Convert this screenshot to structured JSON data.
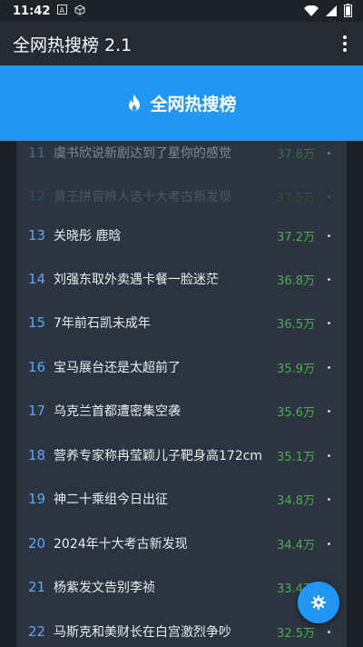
{
  "status": {
    "time": "11:42"
  },
  "app": {
    "title": "全网热搜榜 2.1"
  },
  "banner": {
    "title": "全网热搜榜"
  },
  "list": [
    {
      "rank": "11",
      "title": "虞书欣说新剧达到了星你的感觉",
      "hot": "37.8万"
    },
    {
      "rank": "12",
      "title": "黄王拼音辨人选十大考古新发现",
      "hot": "37.5万"
    },
    {
      "rank": "13",
      "title": "关晓彤 鹿晗",
      "hot": "37.2万"
    },
    {
      "rank": "14",
      "title": "刘强东取外卖遇卡餐一脸迷茫",
      "hot": "36.8万"
    },
    {
      "rank": "15",
      "title": "7年前石凯未成年",
      "hot": "36.5万"
    },
    {
      "rank": "16",
      "title": "宝马展台还是太超前了",
      "hot": "35.9万"
    },
    {
      "rank": "17",
      "title": "乌克兰首都遭密集空袭",
      "hot": "35.6万"
    },
    {
      "rank": "18",
      "title": "营养专家称冉莹颖儿子靶身高172cm",
      "hot": "35.1万"
    },
    {
      "rank": "19",
      "title": "神二十乘组今日出征",
      "hot": "34.8万"
    },
    {
      "rank": "20",
      "title": "2024年十大考古新发现",
      "hot": "34.4万"
    },
    {
      "rank": "21",
      "title": "杨紫发文告别李祯",
      "hot": "33.4万"
    },
    {
      "rank": "22",
      "title": "马斯克和美财长在白宫激烈争吵",
      "hot": "32.5万"
    }
  ],
  "colors": {
    "accent": "#2196f3",
    "hot": "#4caf50",
    "rank": "#5aa7ff"
  },
  "icons": {
    "banner": "fire-icon",
    "fab": "settings-icon",
    "menu": "more-vert-icon"
  }
}
